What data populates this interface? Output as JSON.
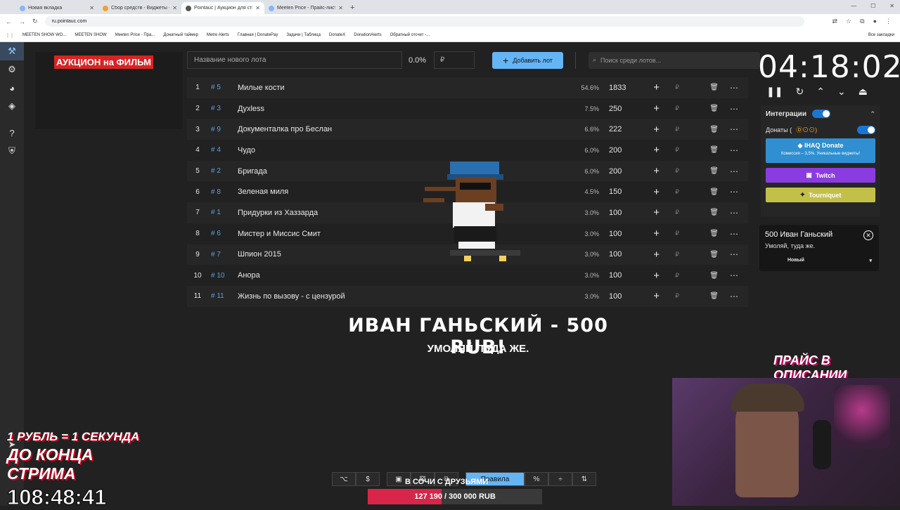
{
  "browser": {
    "tabs": [
      {
        "title": "Новая вкладка"
      },
      {
        "title": "Сбор средств - Виджеты - Do"
      },
      {
        "title": "Pointauc | Аукцион для стрим"
      },
      {
        "title": "Meeten Price - Прайс-лист стр"
      }
    ],
    "url": "ru.pointauc.com",
    "bookmarks": [
      "MEETEN SHOW WO...",
      "MEETEN SHOW",
      "Meeten Price - Пра...",
      "Донатный таймер",
      "Metre Alerts",
      "Главная | DonatePay",
      "Задачи | Таблица",
      "DonateX",
      "DonationAlerts",
      "Обратный отсчет -..."
    ],
    "all_bookmarks": "Все закладки"
  },
  "logo": "АУКЦИОН на ФИЛЬМ",
  "toolbar": {
    "lot_placeholder": "Название нового лота",
    "percent": "0.0%",
    "rub_placeholder": "₽",
    "add_label": "Добавить лот",
    "search_placeholder": "Поиск среди лотов..."
  },
  "lots": [
    {
      "n": "1",
      "id": "# 5",
      "name": "Милые кости",
      "share": "54.6%",
      "amount": "1833"
    },
    {
      "n": "2",
      "id": "# 3",
      "name": "Дyxless",
      "share": "7.5%",
      "amount": "250"
    },
    {
      "n": "3",
      "id": "# 9",
      "name": "Документалка про Беслан",
      "share": "6.6%",
      "amount": "222"
    },
    {
      "n": "4",
      "id": "# 4",
      "name": "Чудо",
      "share": "6.0%",
      "amount": "200"
    },
    {
      "n": "5",
      "id": "# 2",
      "name": "Бригада",
      "share": "6.0%",
      "amount": "200"
    },
    {
      "n": "6",
      "id": "# 8",
      "name": "Зеленая миля",
      "share": "4.5%",
      "amount": "150"
    },
    {
      "n": "7",
      "id": "# 1",
      "name": "Придурки из Хаззарда",
      "share": "3.0%",
      "amount": "100"
    },
    {
      "n": "8",
      "id": "# 6",
      "name": "Мистер и Миссис Смит",
      "share": "3.0%",
      "amount": "100"
    },
    {
      "n": "9",
      "id": "# 7",
      "name": "Шпион 2015",
      "share": "3.0%",
      "amount": "100"
    },
    {
      "n": "10",
      "id": "# 10",
      "name": "Анора",
      "share": "3.0%",
      "amount": "100"
    },
    {
      "n": "11",
      "id": "# 11",
      "name": "Жизнь по вызову - с цензурой",
      "share": "3.0%",
      "amount": "100"
    }
  ],
  "rub_sign": "₽",
  "overlay": {
    "title": "ИВАН ГАНЬСКИЙ - 500 RUB!",
    "subtitle": "УМОЛЯЙ, ТУДА ЖЕ."
  },
  "timer": "04:18:02",
  "integrations": {
    "title": "Интеграции",
    "donations": "Донаты (",
    "ihaq_title": "IHAQ Donate",
    "ihaq_sub": "Комиссия – 3,5%. Уникальные виджеты!",
    "twitch": "Twitch",
    "tourniquet": "Tourniquet"
  },
  "notification": {
    "line1": "500 Иван Ганьский",
    "line2": "Умоляй, туда же.",
    "status": "Новый"
  },
  "promo": "ПРАЙС В ОПИСАНИИ",
  "stream_overlay": {
    "rate": "1 РУБЛЬ = 1 СЕКУНДА",
    "until_end": "ДО КОНЦА СТРИМА",
    "countdown": "108:48:41"
  },
  "bottom": {
    "rules": "Правила",
    "goal_label": "В СОЧИ С ДРУЗЬЯМИ",
    "goal_text": "127 190 / 300 000 RUB",
    "goal_progress": 0.424
  },
  "colors": {
    "accent": "#64b5f6",
    "red": "#d92323",
    "twitch": "#8a3ce0"
  }
}
